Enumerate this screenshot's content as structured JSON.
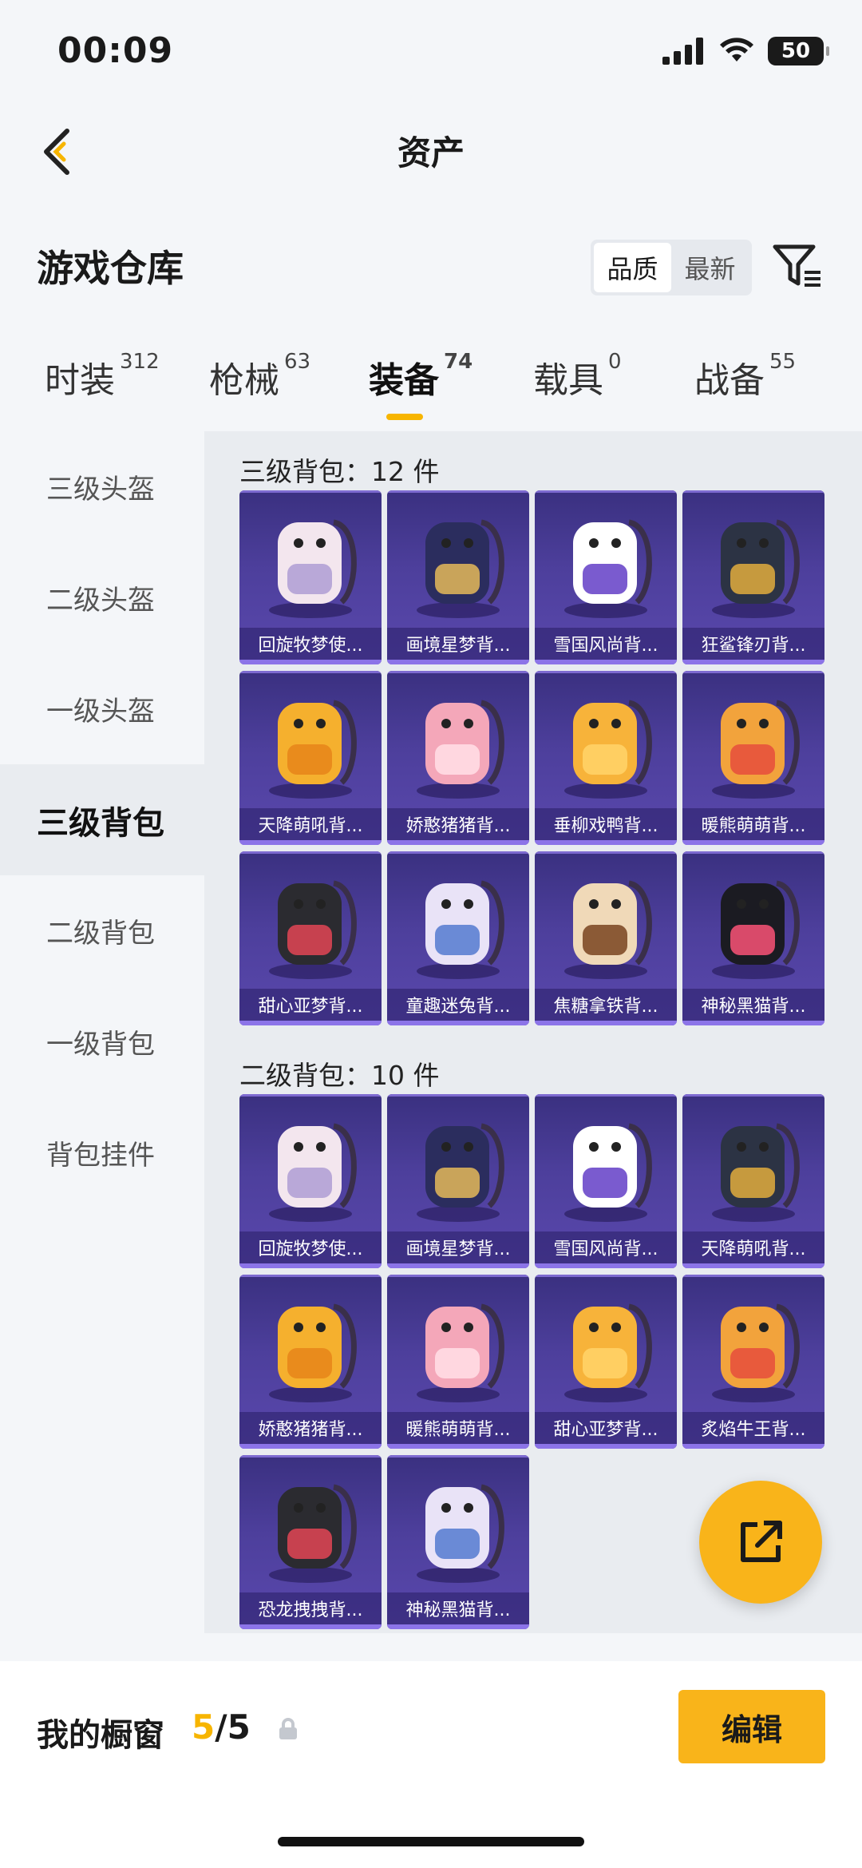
{
  "status": {
    "time": "00:09",
    "battery": "50"
  },
  "header": {
    "title": "资产"
  },
  "warehouse": {
    "title": "游戏仓库",
    "sort_options": [
      "品质",
      "最新"
    ]
  },
  "tabs": [
    {
      "label": "时装",
      "count": "312"
    },
    {
      "label": "枪械",
      "count": "63"
    },
    {
      "label": "装备",
      "count": "74"
    },
    {
      "label": "载具",
      "count": "0"
    },
    {
      "label": "战备",
      "count": "55"
    }
  ],
  "sidebar": {
    "items": [
      "三级头盔",
      "二级头盔",
      "一级头盔",
      "三级背包",
      "二级背包",
      "一级背包",
      "背包挂件"
    ]
  },
  "groups": [
    {
      "title": "三级背包：12 件",
      "items": [
        "回旋牧梦使...",
        "画境星梦背...",
        "雪国风尚背...",
        "狂鲨锋刃背...",
        "天降萌吼背...",
        "娇憨猪猪背...",
        "垂柳戏鸭背...",
        "暖熊萌萌背...",
        "甜心亚梦背...",
        "童趣迷兔背...",
        "焦糖拿铁背...",
        "神秘黑猫背..."
      ]
    },
    {
      "title": "二级背包：10 件",
      "items": [
        "回旋牧梦使...",
        "画境星梦背...",
        "雪国风尚背...",
        "天降萌吼背...",
        "娇憨猪猪背...",
        "暖熊萌萌背...",
        "甜心亚梦背...",
        "炙焰牛王背...",
        "恐龙拽拽背...",
        "神秘黑猫背..."
      ]
    }
  ],
  "showcase": {
    "label": "我的橱窗",
    "current": "5",
    "total": "/5",
    "edit_label": "编辑"
  },
  "colors": {
    "accent": "#f7b500",
    "card_bg": "#4d3f9c"
  }
}
